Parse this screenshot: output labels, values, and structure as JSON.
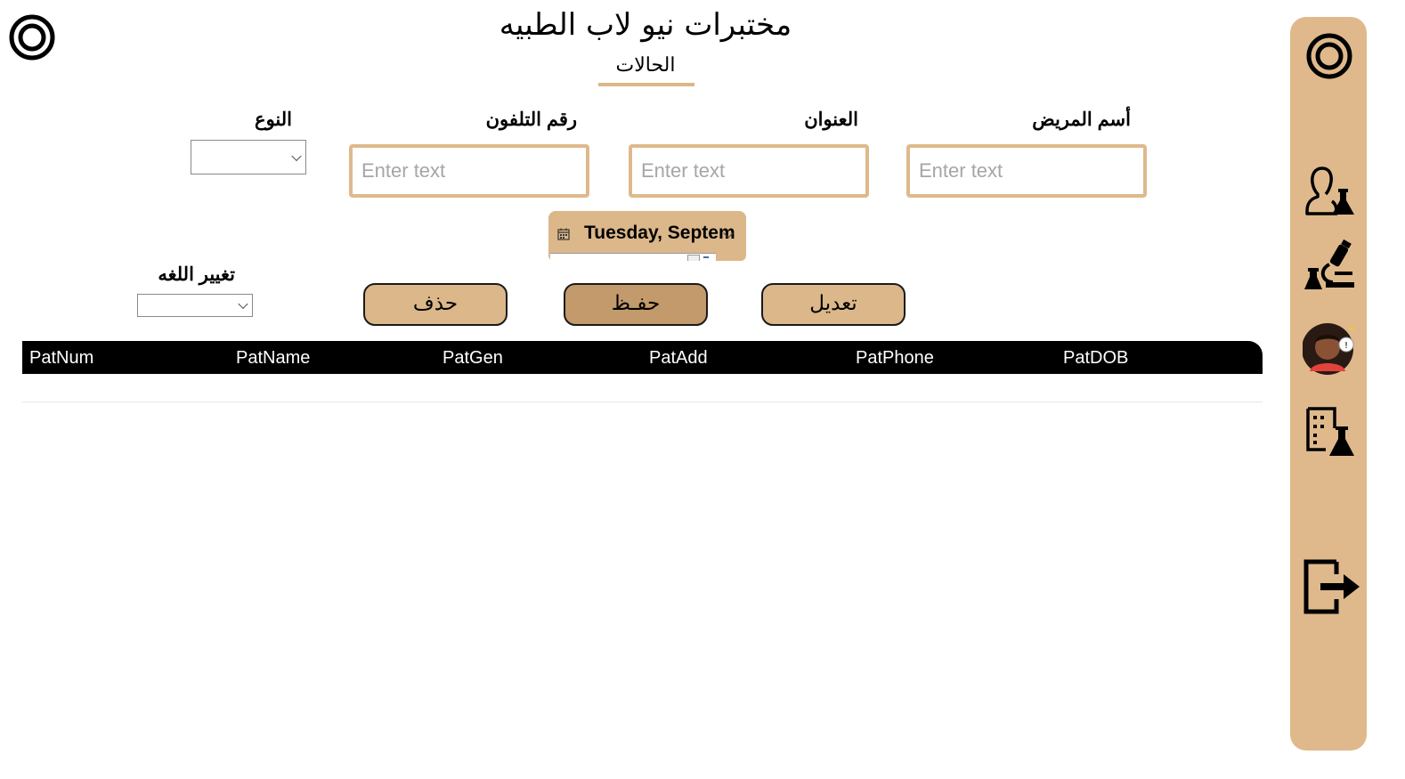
{
  "header": {
    "app_title": "مختبرات نيو لاب الطبيه",
    "page_title": "الحالات"
  },
  "form": {
    "patient_name": {
      "label": "أسم المريض",
      "value": "",
      "placeholder": "Enter text"
    },
    "address": {
      "label": "العنوان",
      "value": "",
      "placeholder": "Enter text"
    },
    "phone": {
      "label": "رقم التلفون",
      "value": "",
      "placeholder": "Enter text"
    },
    "gender": {
      "label": "النوع",
      "selected": ""
    },
    "date_of_birth": {
      "value": "Tuesday, Septem"
    },
    "language": {
      "label": "تغيير اللغه",
      "selected": ""
    }
  },
  "buttons": {
    "delete": "حذف",
    "save": "حفـظ",
    "edit": "تعديل"
  },
  "table": {
    "columns": [
      "PatNum",
      "PatName",
      "PatGen",
      "PatAdd",
      "PatPhone",
      "PatDOB"
    ],
    "rows": []
  },
  "sidebar": {
    "items": [
      {
        "icon": "app-logo-icon"
      },
      {
        "icon": "doctor-lab-icon"
      },
      {
        "icon": "microscope-lab-icon"
      },
      {
        "icon": "patient-avatar-icon"
      },
      {
        "icon": "lab-report-icon"
      },
      {
        "icon": "logout-icon"
      }
    ]
  },
  "colors": {
    "accent": "#dbb78a",
    "save_button": "#c29a6b",
    "table_header": "#000000",
    "input_border": "#dfb98c"
  }
}
